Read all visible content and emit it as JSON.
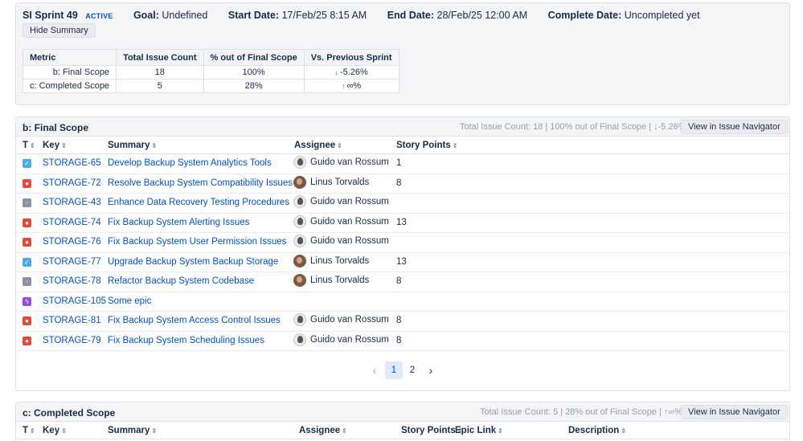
{
  "sprint": {
    "name": "SI Sprint 49",
    "status": "ACTIVE",
    "goal_label": "Goal:",
    "goal": "Undefined",
    "start_label": "Start Date:",
    "start": "17/Feb/25 8:15 AM",
    "end_label": "End Date:",
    "end": "28/Feb/25 12:00 AM",
    "complete_label": "Complete Date:",
    "complete": "Uncompleted yet",
    "hide_summary": "Hide Summary"
  },
  "summary_table": {
    "headers": [
      "Metric",
      "Total Issue Count",
      "% out of Final Scope",
      "Vs. Previous Sprint"
    ],
    "rows": [
      {
        "metric": "b: Final Scope",
        "count": "18",
        "pct": "100%",
        "vs": "-5.26%"
      },
      {
        "metric": "c: Completed Scope",
        "count": "5",
        "pct": "28%",
        "vs": "∞%"
      }
    ]
  },
  "final_scope": {
    "title": "b: Final Scope",
    "info": "Total Issue Count: 18 | 100% out of Final Scope | ↓-5.26%",
    "nav_button": "View in Issue Navigator",
    "columns": [
      "T",
      "Key",
      "Summary",
      "Assignee",
      "Story Points"
    ],
    "rows": [
      {
        "type": "story",
        "key": "STORAGE-65",
        "summary": "Develop Backup System Analytics Tools",
        "assignee": "Guido van Rossum",
        "avatar": "gvr",
        "sp": "1"
      },
      {
        "type": "bug",
        "key": "STORAGE-72",
        "summary": "Resolve Backup System Compatibility Issues",
        "assignee": "Linus Torvalds",
        "avatar": "lt",
        "sp": "8"
      },
      {
        "type": "task",
        "key": "STORAGE-43",
        "summary": "Enhance Data Recovery Testing Procedures",
        "assignee": "Guido van Rossum",
        "avatar": "gvr",
        "sp": ""
      },
      {
        "type": "bug",
        "key": "STORAGE-74",
        "summary": "Fix Backup System Alerting Issues",
        "assignee": "Guido van Rossum",
        "avatar": "gvr",
        "sp": "13"
      },
      {
        "type": "bug",
        "key": "STORAGE-76",
        "summary": "Fix Backup System User Permission Issues",
        "assignee": "Guido van Rossum",
        "avatar": "gvr",
        "sp": ""
      },
      {
        "type": "story",
        "key": "STORAGE-77",
        "summary": "Upgrade Backup System Backup Storage",
        "assignee": "Linus Torvalds",
        "avatar": "lt",
        "sp": "13"
      },
      {
        "type": "task",
        "key": "STORAGE-78",
        "summary": "Refactor Backup System Codebase",
        "assignee": "Linus Torvalds",
        "avatar": "lt",
        "sp": "8"
      },
      {
        "type": "epic",
        "key": "STORAGE-105",
        "summary": "Some epic",
        "assignee": "",
        "avatar": "",
        "sp": ""
      },
      {
        "type": "bug",
        "key": "STORAGE-81",
        "summary": "Fix Backup System Access Control Issues",
        "assignee": "Guido van Rossum",
        "avatar": "gvr",
        "sp": "8"
      },
      {
        "type": "bug",
        "key": "STORAGE-79",
        "summary": "Fix Backup System Scheduling Issues",
        "assignee": "Guido van Rossum",
        "avatar": "gvr",
        "sp": "8"
      }
    ],
    "pages": [
      "1",
      "2"
    ],
    "current_page": "1"
  },
  "completed_scope": {
    "title": "c: Completed Scope",
    "info": "Total Issue Count: 5 | 28% out of Final Scope | ↑∞%",
    "nav_button": "View in Issue Navigator",
    "columns": [
      "T",
      "Key",
      "Summary",
      "Assignee",
      "Story Points",
      "Epic Link",
      "Description"
    ]
  },
  "colors": {
    "link": "#0052cc",
    "story": "#4bade8",
    "bug": "#e5493a",
    "task": "#8993a4",
    "epic": "#904ee2",
    "down": "#de350b",
    "up": "#00875a"
  }
}
